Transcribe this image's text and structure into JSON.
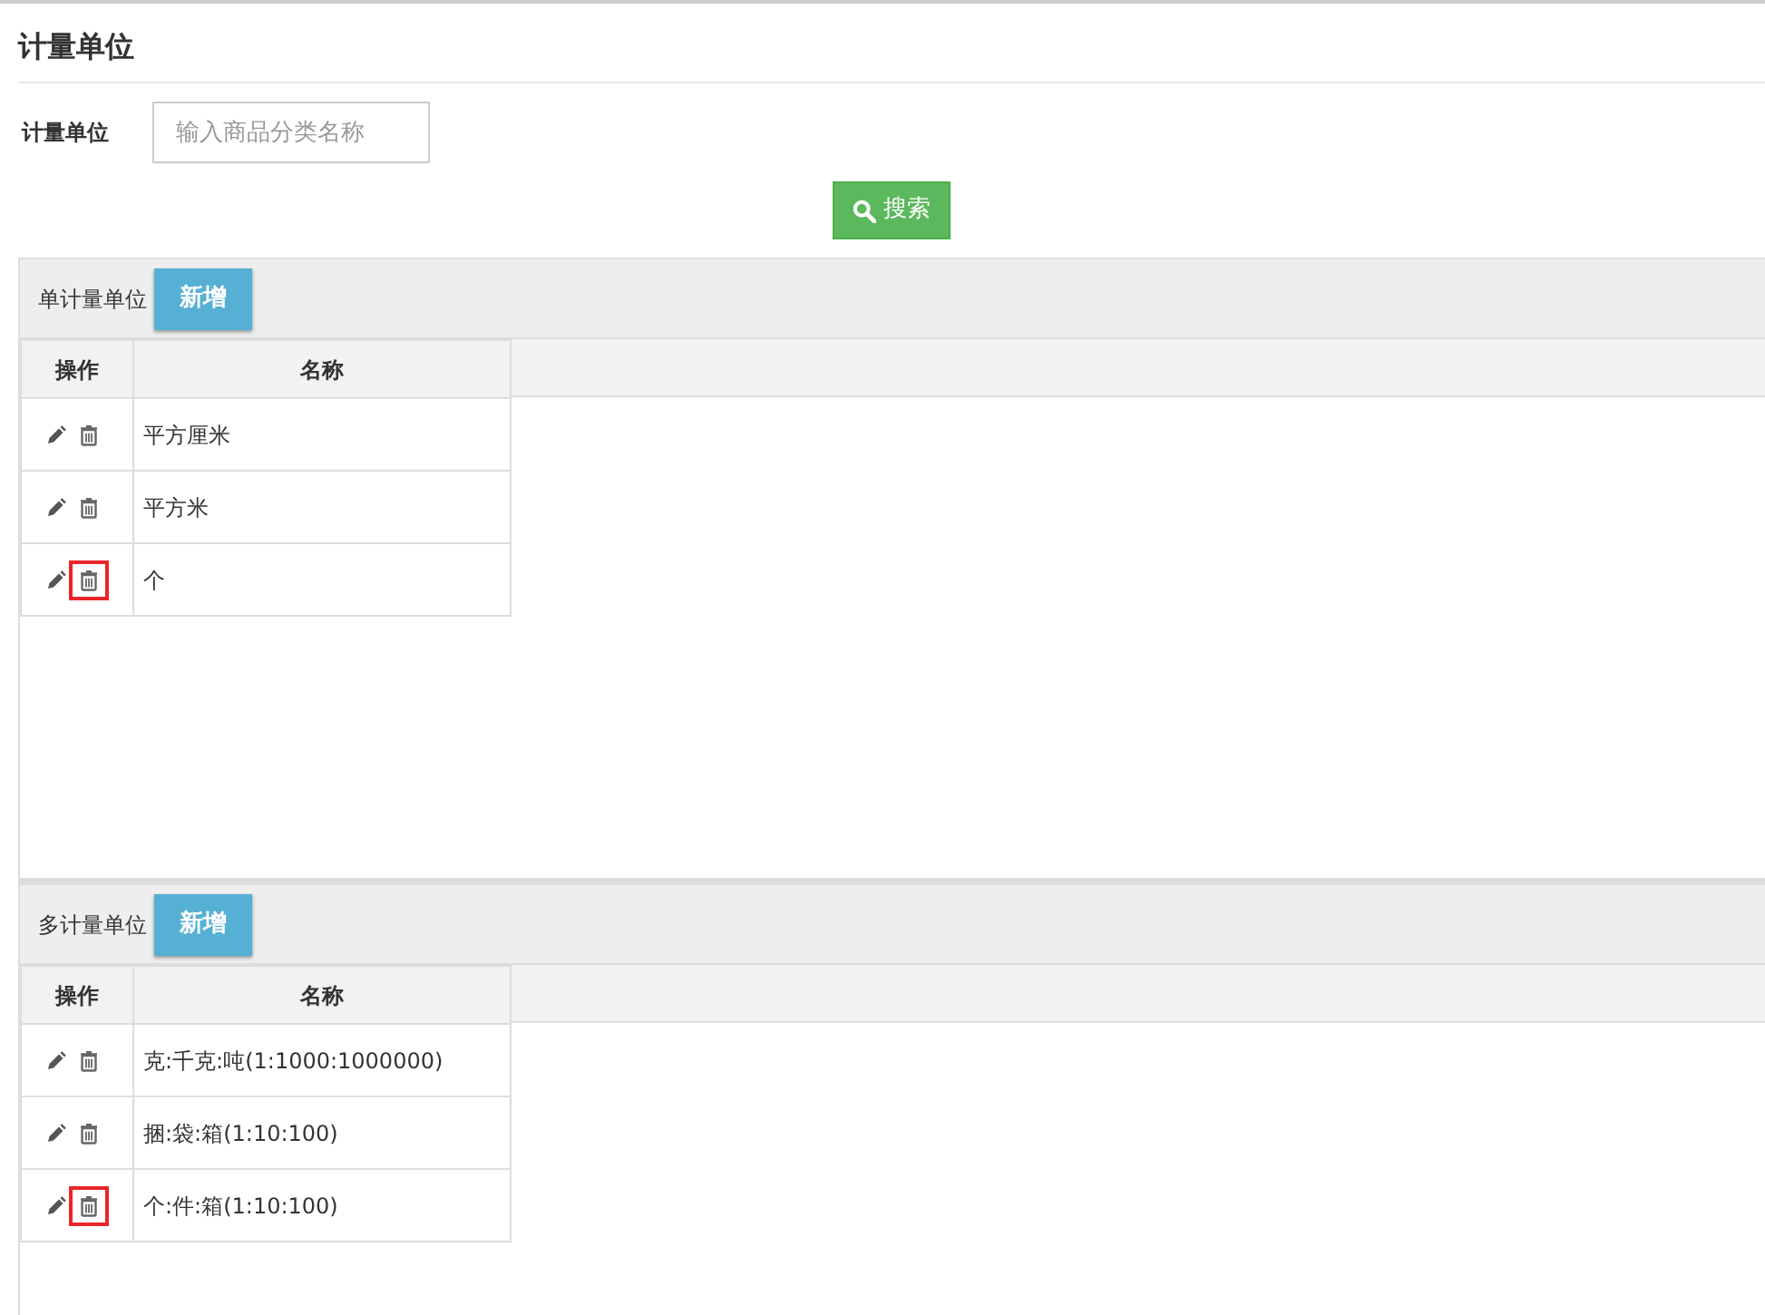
{
  "title": "计量单位",
  "filter": {
    "label": "计量单位",
    "placeholder": "输入商品分类名称"
  },
  "search_button": "搜索",
  "panels": [
    {
      "title": "单计量单位",
      "add_button": "新增",
      "columns": [
        "操作",
        "名称"
      ],
      "rows": [
        {
          "name": "平方厘米",
          "delete_highlighted": false
        },
        {
          "name": "平方米",
          "delete_highlighted": false
        },
        {
          "name": "个",
          "delete_highlighted": true
        }
      ]
    },
    {
      "title": "多计量单位",
      "add_button": "新增",
      "columns": [
        "操作",
        "名称"
      ],
      "rows": [
        {
          "name": "克:千克:吨(1:1000:1000000)",
          "delete_highlighted": false
        },
        {
          "name": "捆:袋:箱(1:10:100)",
          "delete_highlighted": false
        },
        {
          "name": "个:件:箱(1:10:100)",
          "delete_highlighted": true
        }
      ]
    }
  ]
}
